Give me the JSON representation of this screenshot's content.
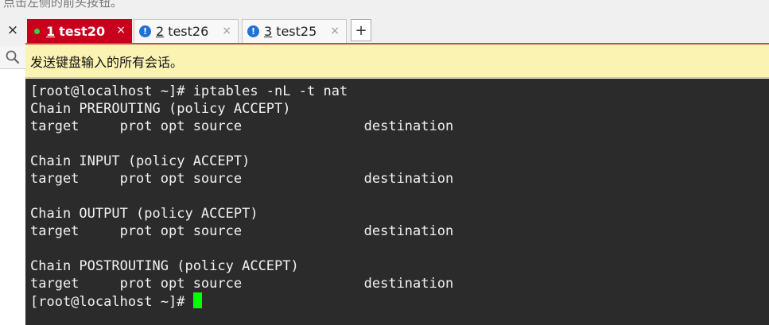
{
  "top_hint": "点击左侧的前头按钮。",
  "tabs": [
    {
      "num": "1",
      "name": "test20",
      "close": "×",
      "active": true
    },
    {
      "num": "2",
      "name": "test26",
      "close": "×",
      "active": false
    },
    {
      "num": "3",
      "name": "test25",
      "close": "×",
      "active": false
    }
  ],
  "new_tab_label": "+",
  "left_close": "×",
  "notice": "发送键盘输入的所有会话。",
  "terminal": {
    "lines": [
      "[root@localhost ~]# iptables -nL -t nat",
      "Chain PREROUTING (policy ACCEPT)",
      "target     prot opt source               destination",
      "",
      "Chain INPUT (policy ACCEPT)",
      "target     prot opt source               destination",
      "",
      "Chain OUTPUT (policy ACCEPT)",
      "target     prot opt source               destination",
      "",
      "Chain POSTROUTING (policy ACCEPT)",
      "target     prot opt source               destination"
    ],
    "prompt": "[root@localhost ~]# "
  },
  "colors": {
    "active_tab": "#c8001e",
    "terminal_bg": "#2b2b2b",
    "cursor": "#00ff00",
    "notice_bg": "#fbf3b2",
    "warning_icon": "#1e72d8",
    "status_dot": "#38d438"
  }
}
